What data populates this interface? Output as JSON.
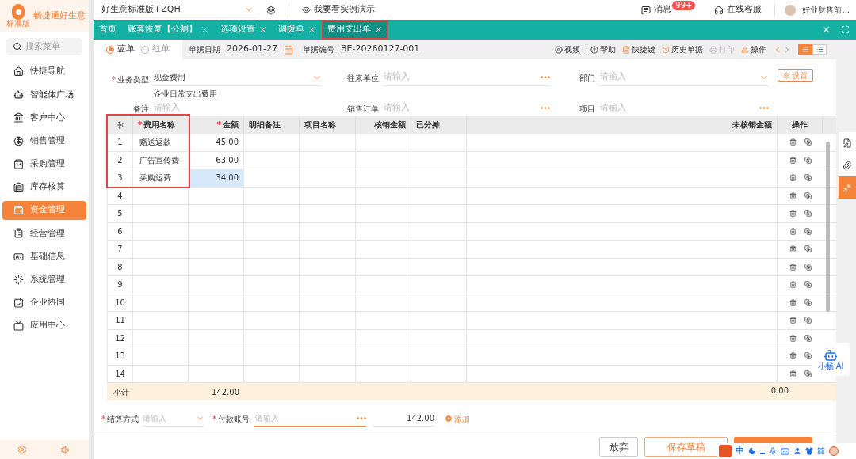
{
  "brand": {
    "name": "畅捷通好生意",
    "edition": "标准版"
  },
  "sidebar": {
    "search_placeholder": "搜索菜单",
    "items": [
      {
        "label": "快捷导航",
        "selected": false
      },
      {
        "label": "智能体广场",
        "selected": false
      },
      {
        "label": "客户中心",
        "selected": false
      },
      {
        "label": "销售管理",
        "selected": false
      },
      {
        "label": "采购管理",
        "selected": false
      },
      {
        "label": "库存核算",
        "selected": false
      },
      {
        "label": "资金管理",
        "selected": true
      },
      {
        "label": "经营管理",
        "selected": false
      },
      {
        "label": "基础信息",
        "selected": false
      },
      {
        "label": "系统管理",
        "selected": false
      },
      {
        "label": "企业协同",
        "selected": false
      },
      {
        "label": "应用中心",
        "selected": false
      }
    ]
  },
  "top_bar": {
    "account": "好生意标准版+ZQH",
    "demo": "我要看实例演示",
    "messages": "消息",
    "message_badge": "99+",
    "support": "在线客服",
    "user": "好业财售前..."
  },
  "tabs": [
    {
      "label": "首页",
      "closable": false,
      "selected": false
    },
    {
      "label": "账套恢复【公测】",
      "closable": true,
      "selected": false
    },
    {
      "label": "选项设置",
      "closable": true,
      "selected": false
    },
    {
      "label": "调拨单",
      "closable": true,
      "selected": false
    },
    {
      "label": "费用支出单",
      "closable": true,
      "selected": true
    }
  ],
  "doc_type": [
    {
      "label": "蓝单",
      "selected": true
    },
    {
      "label": "红单",
      "selected": false
    }
  ],
  "doc_date": {
    "label": "单据日期",
    "value": "2026-01-27"
  },
  "doc_number": {
    "label": "单据编号",
    "value": "BE-20260127-001"
  },
  "toolbar": [
    {
      "label": "视频",
      "disabled": false
    },
    {
      "label": "帮助",
      "disabled": false
    },
    {
      "label": "快捷键",
      "disabled": false
    },
    {
      "label": "历史单据",
      "disabled": false
    },
    {
      "label": "打印",
      "disabled": true
    },
    {
      "label": "操作",
      "disabled": false
    }
  ],
  "form": {
    "business_type": {
      "label": "业务类型",
      "required": true,
      "value": "现金费用",
      "note": "企业日常支出费用"
    },
    "partner": {
      "label": "往来单位",
      "placeholder": "请输入"
    },
    "department": {
      "label": "部门",
      "placeholder": "请输入"
    },
    "settings_button": "设置",
    "remark": {
      "label": "备注",
      "placeholder": "请输入"
    },
    "sales_order": {
      "label": "销售订单",
      "placeholder": "请输入"
    },
    "project": {
      "label": "项目",
      "placeholder": "请输入"
    }
  },
  "required_mark": "*",
  "table": {
    "columns": [
      {
        "label": "费用名称",
        "required": true
      },
      {
        "label": "金额",
        "required": true
      },
      {
        "label": "明细备注",
        "required": false
      },
      {
        "label": "项目名称",
        "required": false
      },
      {
        "label": "核销金额",
        "required": false
      },
      {
        "label": "已分摊",
        "required": false
      },
      {
        "label": "未核销金额",
        "required": false
      },
      {
        "label": "操作",
        "required": false
      }
    ],
    "rows": [
      {
        "no": "1",
        "name": "赠送返款",
        "amount": "45.00",
        "selected": false
      },
      {
        "no": "2",
        "name": "广告宣传费",
        "amount": "63.00",
        "selected": false
      },
      {
        "no": "3",
        "name": "采购运费",
        "amount": "34.00",
        "selected": true
      },
      {
        "no": "4",
        "selected": false
      },
      {
        "no": "5",
        "selected": false
      },
      {
        "no": "6",
        "selected": false
      },
      {
        "no": "7",
        "selected": false
      },
      {
        "no": "8",
        "selected": false
      },
      {
        "no": "9",
        "selected": false
      },
      {
        "no": "10",
        "selected": false
      },
      {
        "no": "11",
        "selected": false
      },
      {
        "no": "12",
        "selected": false
      },
      {
        "no": "13",
        "selected": false
      },
      {
        "no": "14",
        "selected": false
      }
    ],
    "subtotal": {
      "label": "小计",
      "amount": "142.00",
      "unsettled": "0.00"
    }
  },
  "payment": {
    "method": {
      "label": "结算方式",
      "required": true,
      "placeholder": "请输入"
    },
    "account": {
      "label": "付款账号",
      "required": true,
      "placeholder": "请输入",
      "focused": true
    },
    "amount": "142.00",
    "add": "添加"
  },
  "footer": {
    "discard": "放弃",
    "draft": "保存草稿"
  },
  "assistant": {
    "label": "小畅 AI"
  },
  "ime": {
    "mode": "中"
  }
}
